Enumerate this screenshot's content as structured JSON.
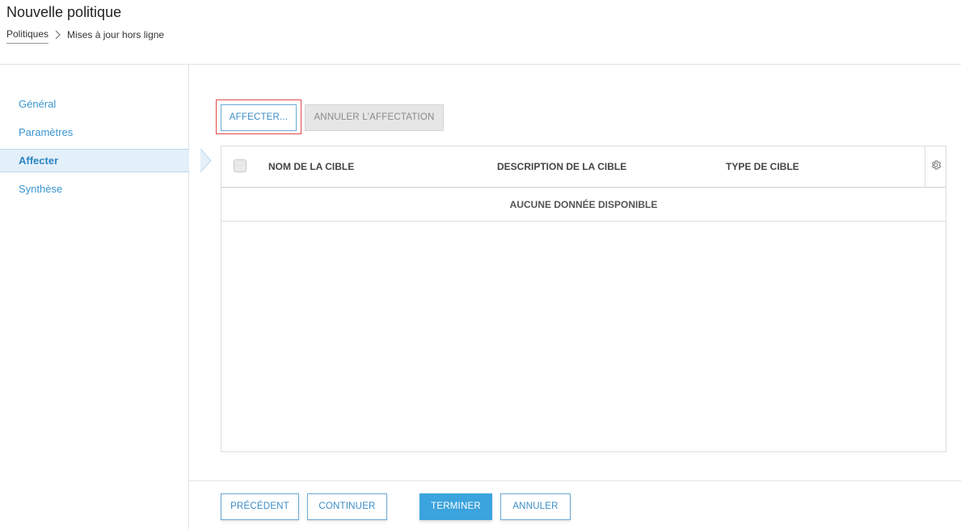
{
  "header": {
    "title": "Nouvelle politique",
    "breadcrumb": {
      "parent": "Politiques",
      "current": "Mises à jour hors ligne"
    }
  },
  "sidebar": {
    "items": [
      {
        "label": "Général",
        "active": false
      },
      {
        "label": "Paramètres",
        "active": false
      },
      {
        "label": "Affecter",
        "active": true
      },
      {
        "label": "Synthèse",
        "active": false
      }
    ]
  },
  "toolbar": {
    "assign_label": "AFFECTER...",
    "unassign_label": "ANNULER L'AFFECTATION"
  },
  "table": {
    "columns": [
      "NOM DE LA CIBLE",
      "DESCRIPTION DE LA CIBLE",
      "TYPE DE CIBLE"
    ],
    "empty_message": "AUCUNE DONNÉE DISPONIBLE",
    "settings_icon": "gear-icon"
  },
  "footer": {
    "previous_label": "PRÉCÉDENT",
    "continue_label": "CONTINUER",
    "finish_label": "TERMINER",
    "cancel_label": "ANNULER"
  },
  "colors": {
    "accent": "#3ba3dd",
    "link": "#3a96d0",
    "highlight": "#e04a4a"
  }
}
